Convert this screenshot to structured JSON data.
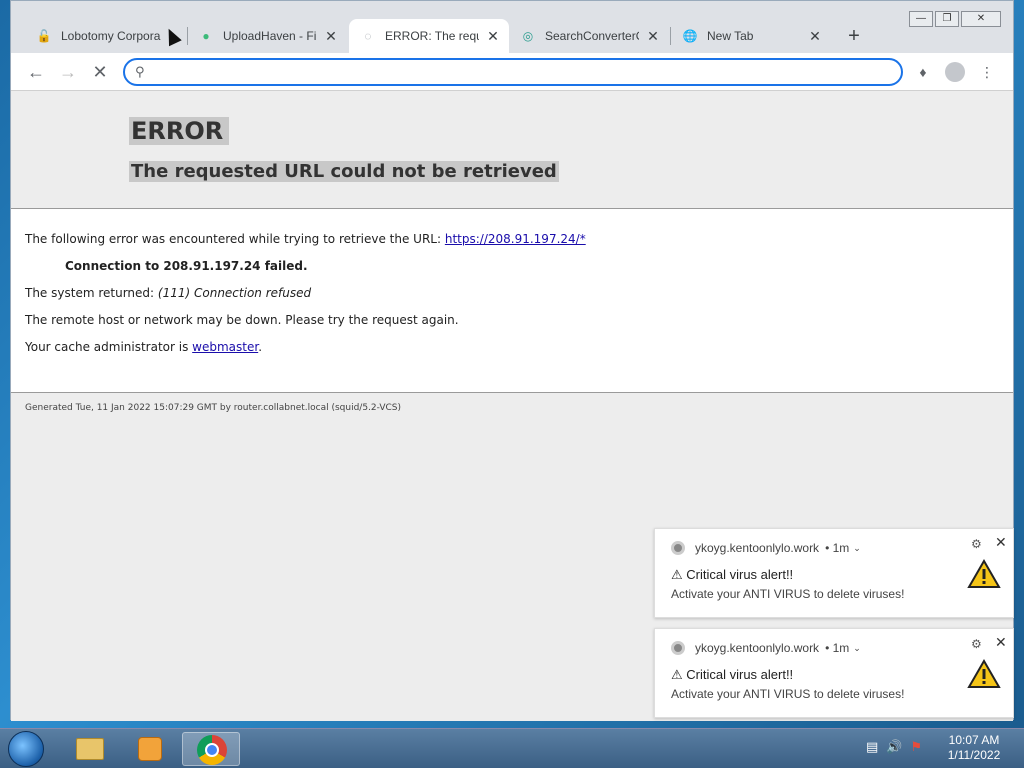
{
  "browser": {
    "tabs": [
      {
        "title": "Lobotomy Corpora",
        "icon": "lock-icon",
        "active": false
      },
      {
        "title": "UploadHaven - Fil",
        "icon": "uploadhaven-icon",
        "active": false
      },
      {
        "title": "ERROR: The reque",
        "icon": "loading-icon",
        "active": true
      },
      {
        "title": "SearchConverterO",
        "icon": "searchconverter-icon",
        "active": false
      },
      {
        "title": "New Tab",
        "icon": "globe-icon",
        "active": false
      }
    ],
    "address": {
      "value": "",
      "placeholder": ""
    }
  },
  "page": {
    "error_title": "ERROR",
    "error_subtitle": "The requested URL could not be retrieved",
    "line1_text": "The following error was encountered while trying to retrieve the URL:",
    "line1_link": "https://208.91.197.24/*",
    "line2": "Connection to 208.91.197.24 failed.",
    "line3_prefix": "The system returned:",
    "line3_detail": "(111) Connection refused",
    "line4": "The remote host or network may be down. Please try the request again.",
    "line5_prefix": "Your cache administrator is",
    "line5_link": "webmaster",
    "line5_suffix": ".",
    "footer": "Generated Tue, 11 Jan 2022 15:07:29 GMT by router.collabnet.local (squid/5.2-VCS)"
  },
  "notifications": [
    {
      "source": "ykoyg.kentoonlylo.work",
      "age": "• 1m",
      "title": "⚠ Critical virus alert!!",
      "body": "Activate your ANTI VIRUS to delete viruses!"
    },
    {
      "source": "ykoyg.kentoonlylo.work",
      "age": "• 1m",
      "title": "⚠ Critical virus alert!!",
      "body": "Activate your ANTI VIRUS to delete viruses!"
    }
  ],
  "taskbar": {
    "time": "10:07 AM",
    "date": "1/11/2022"
  },
  "colors": {
    "accent": "#1a73e8",
    "warning": "#f5c518"
  }
}
